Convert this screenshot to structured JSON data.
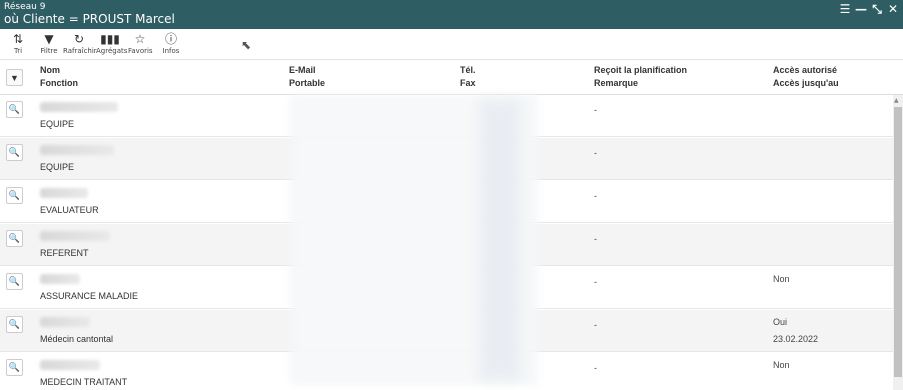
{
  "window": {
    "network": "Réseau 9",
    "title": "où Cliente = PROUST Marcel",
    "controls": [
      "list-icon",
      "minimize-icon",
      "restore-icon",
      "close-icon"
    ]
  },
  "toolbar": {
    "items": [
      {
        "label": "Tri",
        "icon": "sort-icon"
      },
      {
        "label": "Filtre",
        "icon": "filter-icon"
      },
      {
        "label": "Rafraîchir",
        "icon": "refresh-icon"
      },
      {
        "label": "Agrégats",
        "icon": "chart-icon"
      },
      {
        "label": "Favoris",
        "icon": "star-icon"
      },
      {
        "label": "Infos",
        "icon": "info-icon"
      }
    ]
  },
  "header": {
    "nom": "Nom",
    "fonction": "Fonction",
    "email": "E-Mail",
    "portable": "Portable",
    "tel": "Tél.",
    "fax": "Fax",
    "planif": "Reçoit la planification",
    "remarque": "Remarque",
    "acces": "Accès autorisé",
    "acces_jusqu": "Accès jusqu'au"
  },
  "rows": [
    {
      "fonction": "EQUIPE",
      "planif": "-",
      "acces": "",
      "acces_jusqu": ""
    },
    {
      "fonction": "EQUIPE",
      "planif": "-",
      "acces": "",
      "acces_jusqu": ""
    },
    {
      "fonction": "EVALUATEUR",
      "planif": "-",
      "acces": "",
      "acces_jusqu": ""
    },
    {
      "fonction": "REFERENT",
      "planif": "-",
      "acces": "",
      "acces_jusqu": ""
    },
    {
      "fonction": "ASSURANCE MALADIE",
      "planif": "-",
      "acces": "Non",
      "acces_jusqu": ""
    },
    {
      "fonction": "Médecin cantontal",
      "planif": "-",
      "acces": "Oui",
      "acces_jusqu": "23.02.2022"
    },
    {
      "fonction": "MEDECIN TRAITANT",
      "planif": "-",
      "acces": "Non",
      "acces_jusqu": ""
    }
  ]
}
